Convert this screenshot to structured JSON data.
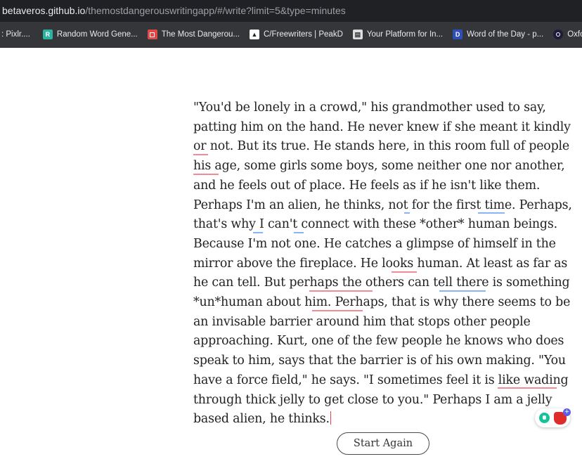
{
  "browser": {
    "url_host": "betaveros.github.io",
    "url_path": "/themostdangerouswritingapp/#/write?limit=5&type=minutes"
  },
  "bookmarks": [
    {
      "label": ": Pixlr....",
      "icon": "pixlr-icon",
      "color": "#3a3b3f"
    },
    {
      "label": "Random Word Gene...",
      "icon": "random-word-icon",
      "color": "#2bb3a0"
    },
    {
      "label": "The Most Dangerou...",
      "icon": "dangerous-app-icon",
      "color": "#e04848"
    },
    {
      "label": "C/Freewriters | PeakD",
      "icon": "peakd-icon",
      "color": "#ffffff"
    },
    {
      "label": "Your Platform for In...",
      "icon": "platform-icon",
      "color": "#dddddd"
    },
    {
      "label": "Word of the Day - p...",
      "icon": "dictionary-icon",
      "color": "#2f4fb8"
    },
    {
      "label": "Oxford Engl",
      "icon": "oxford-icon",
      "color": "#1c1c3a"
    }
  ],
  "writing": {
    "text": "\"You'd be lonely in a crowd,\" his grandmother used to say, patting him on the hand. He never knew if she meant it kindly or not. But its true. He stands here, in this room full of people his age, some girls some boys, some neither one nor another, and he feels out of place. He feels as if he isn't like them. Perhaps I'm an alien, he thinks, not for the first time. Perhaps, that's why I can't connect with these *other* human beings. Because I'm not one. He catches a glimpse of himself in the mirror above the fireplace. He looks human. At least as far as he can tell. But perhaps the others can tell there is something *un*human about him. Perhaps, that is why there seems to be an invisable barrier around him that stops other people approaching. Kurt, one of the few people he knows who does speak to him, says that the barrier is of his own making. \"You have a force field,\" he says. \"I sometimes feel it is like wading through thick jelly to get close to you.\" Perhaps I am a jelly based alien, he thinks."
  },
  "controls": {
    "start_again": "Start Again"
  },
  "extensions": {
    "widget": "grammar-checker-widget"
  }
}
